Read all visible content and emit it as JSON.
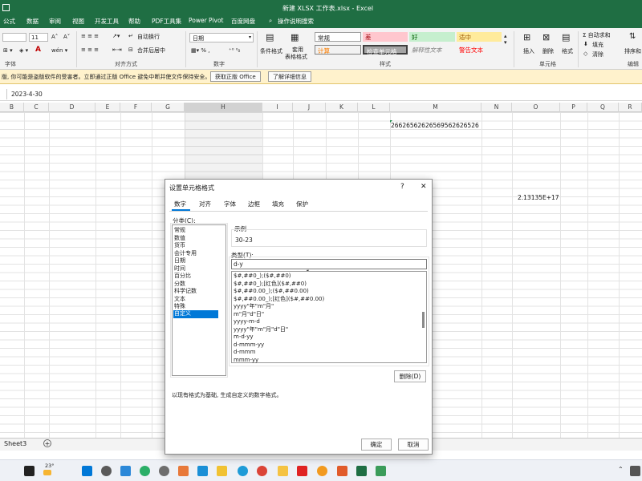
{
  "title_bar": {
    "text": "新建 XLSX 工作表.xlsx  -  Excel"
  },
  "tabs": [
    "公式",
    "数据",
    "审阅",
    "视图",
    "开发工具",
    "帮助",
    "PDF工具集",
    "Power Pivot",
    "百度网盘",
    "操作说明搜索"
  ],
  "ribbon": {
    "font_size": "11",
    "number_format": "日期",
    "align_wrap": "自动换行",
    "align_merge": "合并后居中",
    "cond_format": "条件格式",
    "table_format_1": "套用",
    "table_format_2": "表格格式",
    "styles": {
      "normal": "常规",
      "bad": "差",
      "good": "好",
      "neutral": "适中",
      "calc": "计算",
      "check": "检查单元格",
      "explain": "解释性文本",
      "warning": "警告文本"
    },
    "cells": {
      "insert": "插入",
      "delete": "删除",
      "format": "格式"
    },
    "editing": {
      "autosum": "Σ 自动求和",
      "fill": "填充",
      "clear": "清除",
      "sort": "排序和"
    },
    "groups": {
      "font": "字体",
      "align": "对齐方式",
      "number": "数字",
      "style": "样式",
      "cells": "单元格",
      "edit": "编辑"
    }
  },
  "security": {
    "message": "版, 你可能是盗版软件的受害者。立即通过正版 Office 避免中断并使文件保持安全。",
    "button1": "获取正版 Office",
    "button2": "了解详细信息"
  },
  "formula_bar": {
    "value": "2023-4-30"
  },
  "columns": [
    "B",
    "C",
    "D",
    "E",
    "F",
    "G",
    "H",
    "I",
    "J",
    "K",
    "L",
    "M",
    "N",
    "O",
    "P",
    "Q",
    "R"
  ],
  "cells": {
    "m_value": "26626562626569562626526",
    "o_value": "2.13135E+17"
  },
  "sheet_tab": "Sheet3",
  "dialog": {
    "title": "设置单元格格式",
    "help": "?",
    "close": "✕",
    "tabs": [
      "数字",
      "对齐",
      "字体",
      "边框",
      "填充",
      "保护"
    ],
    "category_label": "分类(C):",
    "categories": [
      "常规",
      "数值",
      "货币",
      "会计专用",
      "日期",
      "时间",
      "百分比",
      "分数",
      "科学记数",
      "文本",
      "特殊",
      "自定义"
    ],
    "selected_category": "自定义",
    "sample_label": "示例",
    "sample_value": "30-23",
    "type_label": "类型(T):",
    "type_value": "d-y",
    "formats": [
      "$#,##0_);($#,##0)",
      "$#,##0_);[红色]($#,##0)",
      "$#,##0.00_);($#,##0.00)",
      "$#,##0.00_);[红色]($#,##0.00)",
      "yyyy\"年\"m\"月\"",
      "m\"月\"d\"日\"",
      "yyyy-m-d",
      "yyyy\"年\"m\"月\"d\"日\"",
      "m-d-yy",
      "d-mmm-yy",
      "d-mmm",
      "mmm-yy"
    ],
    "delete_btn": "删除(D)",
    "hint": "以现有格式为基础, 生成自定义的数字格式。",
    "ok": "确定",
    "cancel": "取消"
  },
  "taskbar": {
    "weather": "23°"
  },
  "colors": {
    "excel_green": "#1f6e43",
    "accent_blue": "#0078d7",
    "security_bg": "#fff2cc"
  }
}
